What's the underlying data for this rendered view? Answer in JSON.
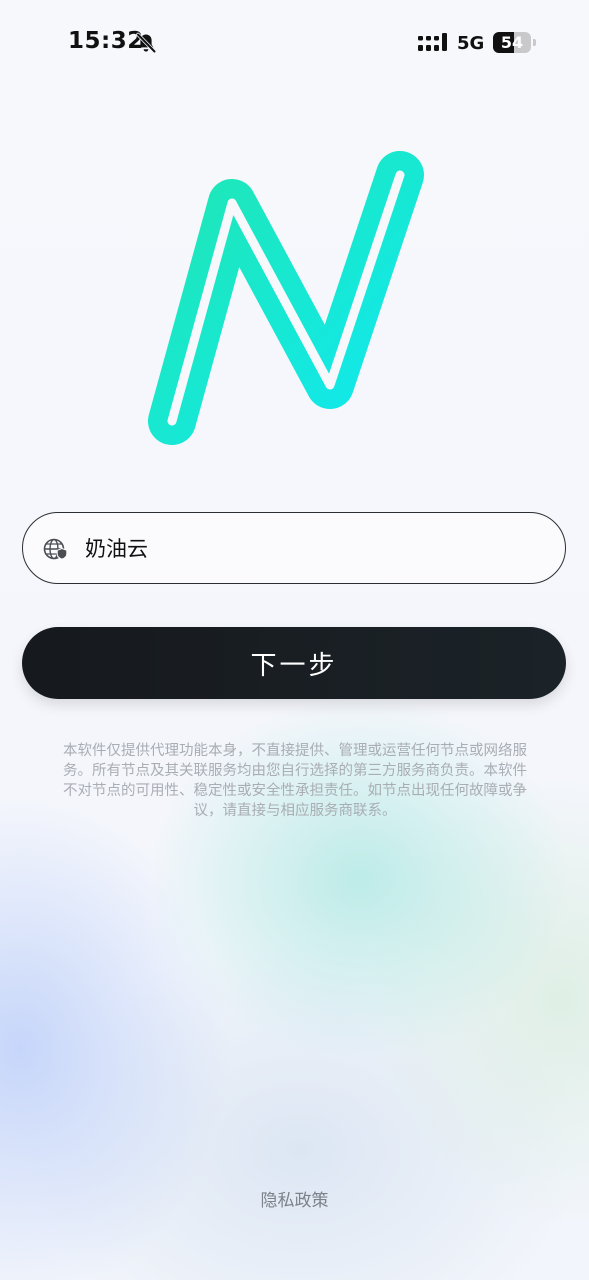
{
  "status_bar": {
    "time": "15:32",
    "network": "5G",
    "battery_level": "54",
    "battery_fraction": 0.54,
    "silent_icon": "bell-slash-icon",
    "signal_icon": "signal-icon"
  },
  "logo": {
    "icon": "n-logo-icon",
    "gradient_start": "#1fe7b4",
    "gradient_end": "#10e8f0"
  },
  "server_field": {
    "icon": "globe-icon",
    "value": "奶油云"
  },
  "next_button": {
    "label": "下一步"
  },
  "disclaimer": {
    "text": "本软件仅提供代理功能本身，不直接提供、管理或运营任何节点或网络服务。所有节点及其关联服务均由您自行选择的第三方服务商负责。本软件不对节点的可用性、稳定性或安全性承担责任。如节点出现任何故障或争议，请直接与相应服务商联系。"
  },
  "footer": {
    "privacy_label": "隐私政策"
  }
}
